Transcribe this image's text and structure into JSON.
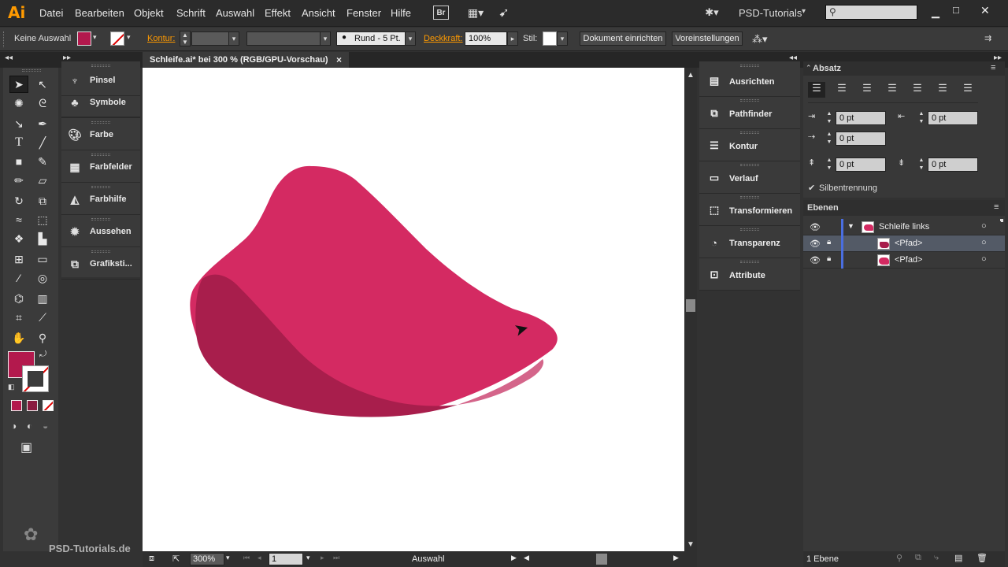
{
  "menubar": {
    "app_logo": "Ai",
    "items": [
      "Datei",
      "Bearbeiten",
      "Objekt",
      "Schrift",
      "Auswahl",
      "Effekt",
      "Ansicht",
      "Fenster",
      "Hilfe"
    ],
    "bridge_label": "Br",
    "workspace": "PSD-Tutorials",
    "search_placeholder": ""
  },
  "controlbar": {
    "selection": "Keine Auswahl",
    "kontur_label": "Kontur:",
    "brush_value": "Rund - 5 Pt.",
    "deckkraft_label": "Deckkraft:",
    "deckkraft_value": "100%",
    "stil_label": "Stil:",
    "doc_setup_button": "Dokument einrichten",
    "prefs_button": "Voreinstellungen"
  },
  "document_tab": {
    "title": "Schleife.ai* bei 300 % (RGB/GPU-Vorschau)",
    "close": "×"
  },
  "left_panels": [
    {
      "label": "Pinsel",
      "icon": "brush-icon"
    },
    {
      "label": "Symbole",
      "icon": "symbols-icon"
    },
    {
      "label": "Farbe",
      "icon": "palette-icon"
    },
    {
      "label": "Farbfelder",
      "icon": "swatches-icon"
    },
    {
      "label": "Farbhilfe",
      "icon": "color-guide-icon"
    },
    {
      "label": "Aussehen",
      "icon": "appearance-icon"
    },
    {
      "label": "Grafiksti...",
      "icon": "graphic-styles-icon"
    }
  ],
  "right_panels": [
    {
      "label": "Ausrichten",
      "icon": "align-icon"
    },
    {
      "label": "Pathfinder",
      "icon": "pathfinder-icon"
    },
    {
      "label": "Kontur",
      "icon": "stroke-icon"
    },
    {
      "label": "Verlauf",
      "icon": "gradient-icon"
    },
    {
      "label": "Transformieren",
      "icon": "transform-icon"
    },
    {
      "label": "Transparenz",
      "icon": "transparency-icon"
    },
    {
      "label": "Attribute",
      "icon": "attributes-icon"
    }
  ],
  "absatz": {
    "title": "Absatz",
    "indent_left": "0 pt",
    "indent_right": "0 pt",
    "first_line": "0 pt",
    "space_before": "0 pt",
    "space_after": "0 pt",
    "hyphenation_label": "Silbentrennung",
    "hyphenation_checked": true
  },
  "ebenen": {
    "title": "Ebenen",
    "layers": [
      {
        "name": "Schleife links",
        "type": "layer"
      },
      {
        "name": "<Pfad>",
        "type": "path"
      },
      {
        "name": "<Pfad>",
        "type": "path"
      }
    ],
    "footer": "1 Ebene"
  },
  "statusbar": {
    "zoom": "300%",
    "artboard": "1",
    "tool": "Auswahl"
  },
  "watermark": "PSD-Tutorials.de",
  "colors": {
    "fill": "#b3194d",
    "shape_main": "#d42a62",
    "shape_shadow": "#a81e4c",
    "accent_orange": "#ff9a00"
  }
}
